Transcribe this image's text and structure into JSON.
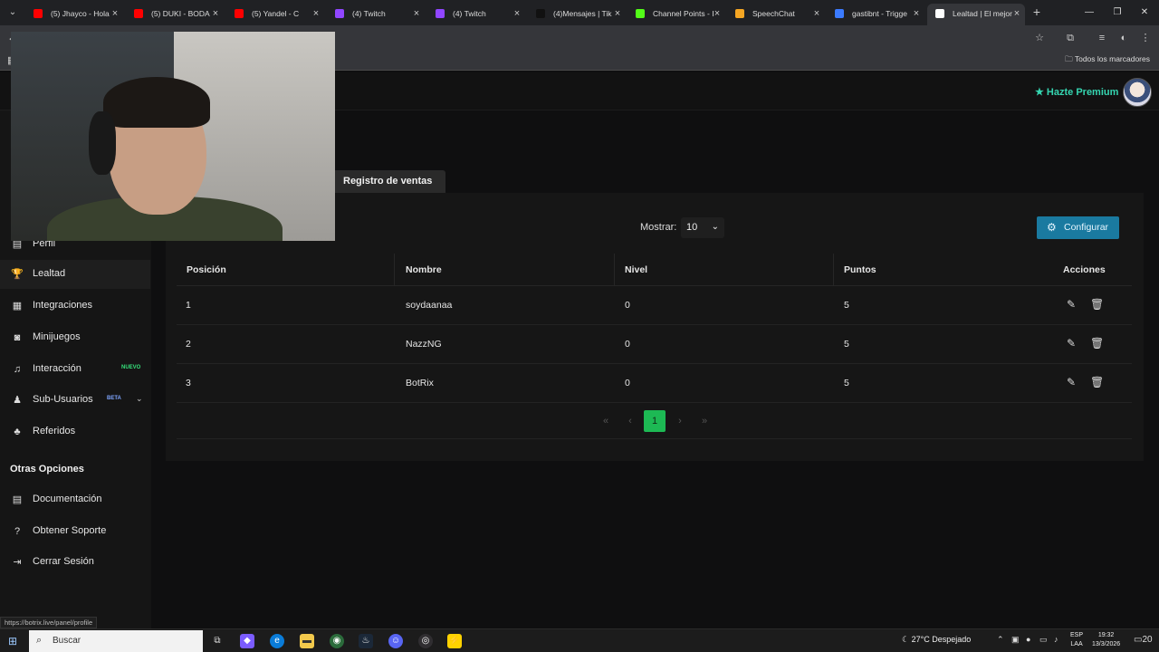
{
  "browser": {
    "tabs": [
      {
        "title": "(5) Jhayco - Hola",
        "icon": "youtube-icon",
        "color": "#ff0000"
      },
      {
        "title": "(5) DUKI - BODA",
        "icon": "youtube-icon",
        "color": "#ff0000"
      },
      {
        "title": "(5) Yandel - C",
        "icon": "youtube-icon",
        "color": "#ff0000"
      },
      {
        "title": "(4) Twitch",
        "icon": "twitch-icon",
        "color": "#9146ff"
      },
      {
        "title": "(4) Twitch",
        "icon": "twitch-icon",
        "color": "#9146ff"
      },
      {
        "title": "(4)Mensajes | Tik",
        "icon": "tiktok-icon",
        "color": "#111111"
      },
      {
        "title": "Channel Points - I",
        "icon": "kick-icon",
        "color": "#53fc18"
      },
      {
        "title": "SpeechChat",
        "icon": "speechchat-icon",
        "color": "#f5a623"
      },
      {
        "title": "gastibnt - Trigge",
        "icon": "trigger-icon",
        "color": "#3b7bff"
      },
      {
        "title": "Lealtad | El mejor",
        "icon": "botrix-icon",
        "color": "#ffffff"
      }
    ],
    "bookmarks_label": "Todos los marcadores",
    "status_url": "https://botrix.live/panel/profile"
  },
  "header": {
    "premium_label": "Hazte Premium"
  },
  "sidebar": {
    "items": [
      {
        "label": "Perfil",
        "icon": "profile-icon",
        "glyph": "▤"
      },
      {
        "label": "Lealtad",
        "icon": "trophy-icon",
        "glyph": "🏆"
      },
      {
        "label": "Integraciones",
        "icon": "integrations-icon",
        "glyph": "▦"
      },
      {
        "label": "Minijuegos",
        "icon": "gamepad-icon",
        "glyph": "◙"
      },
      {
        "label": "Interacción",
        "icon": "music-icon",
        "glyph": "♫",
        "badge": "NUEVO"
      },
      {
        "label": "Sub-Usuarios",
        "icon": "users-icon",
        "glyph": "♟",
        "badge": "BETA"
      },
      {
        "label": "Referidos",
        "icon": "referrals-icon",
        "glyph": "♣"
      }
    ],
    "other_options_title": "Otras Opciones",
    "other_items": [
      {
        "label": "Documentación",
        "icon": "document-icon",
        "glyph": "▤"
      },
      {
        "label": "Obtener Soporte",
        "icon": "help-icon",
        "glyph": "?"
      },
      {
        "label": "Cerrar Sesión",
        "icon": "logout-icon",
        "glyph": "⇥"
      }
    ]
  },
  "main": {
    "tab_label": "Registro de ventas",
    "show_label": "Mostrar:",
    "show_value": "10",
    "configure_label": "Configurar",
    "columns": [
      "Posición",
      "Nombre",
      "Nivel",
      "Puntos",
      "Acciones"
    ],
    "rows": [
      {
        "position": "1",
        "name": "soydaanaa",
        "level": "0",
        "points": "5"
      },
      {
        "position": "2",
        "name": "NazzNG",
        "level": "0",
        "points": "5"
      },
      {
        "position": "3",
        "name": "BotRix",
        "level": "0",
        "points": "5"
      }
    ],
    "pagination": {
      "current": "1"
    }
  },
  "taskbar": {
    "search_placeholder": "Buscar",
    "weather": "27°C  Despejado",
    "lang_top": "ESP",
    "lang_bottom": "LAA",
    "time": "19:32",
    "date": "13/3/2026",
    "notif_count": "20"
  }
}
